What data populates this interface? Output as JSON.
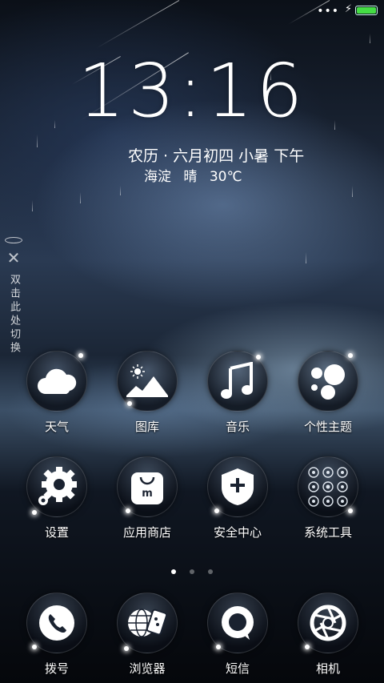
{
  "status_bar": {
    "signal_dots": "•••",
    "charging_icon": "bolt-icon",
    "battery_level": 1.0,
    "battery_color": "#44dd44"
  },
  "lockscreen": {
    "time": "13:16",
    "lunar_date": "农历 · 六月初四 小暑 下午",
    "weather": {
      "location": "海淀",
      "condition": "晴",
      "temperature": "30℃"
    }
  },
  "side_switcher": {
    "close_icon": "close-icon",
    "hint_text": "双击此处切换"
  },
  "apps": [
    {
      "label": "天气",
      "icon": "weather-cloud-icon"
    },
    {
      "label": "图库",
      "icon": "gallery-landscape-icon"
    },
    {
      "label": "音乐",
      "icon": "music-note-icon"
    },
    {
      "label": "个性主题",
      "icon": "theme-bubbles-icon"
    },
    {
      "label": "设置",
      "icon": "settings-gear-icon"
    },
    {
      "label": "应用商店",
      "icon": "app-store-bag-icon"
    },
    {
      "label": "安全中心",
      "icon": "security-shield-icon"
    },
    {
      "label": "系统工具",
      "icon": "system-tools-icon"
    }
  ],
  "pager": {
    "count": 3,
    "active": 0
  },
  "dock": [
    {
      "label": "拨号",
      "icon": "phone-icon"
    },
    {
      "label": "浏览器",
      "icon": "browser-globe-icon"
    },
    {
      "label": "短信",
      "icon": "message-bubble-icon"
    },
    {
      "label": "相机",
      "icon": "camera-lens-icon"
    }
  ]
}
